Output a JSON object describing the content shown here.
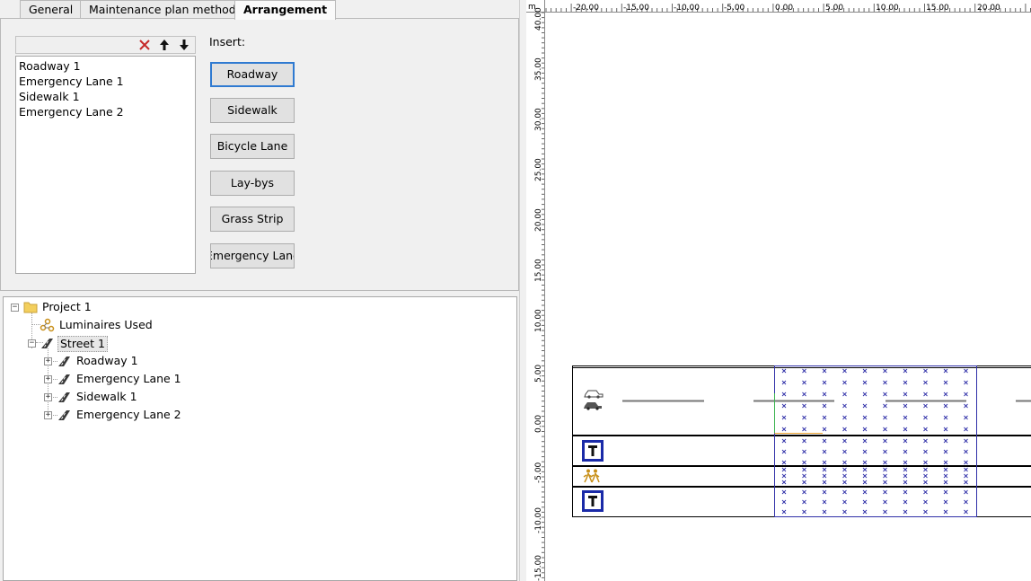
{
  "tabs": [
    {
      "label": "General"
    },
    {
      "label": "Maintenance plan method"
    },
    {
      "label": "Arrangement"
    }
  ],
  "arrangement": {
    "list_items": [
      "Roadway 1",
      "Emergency Lane 1",
      "Sidewalk 1",
      "Emergency Lane 2"
    ],
    "insert_label": "Insert:",
    "insert_buttons": [
      "Roadway",
      "Sidewalk",
      "Bicycle Lane",
      "Lay-bys",
      "Grass Strip",
      "Emergency Lane"
    ],
    "toolbar_icons": [
      "delete-icon",
      "move-up-icon",
      "move-down-icon"
    ]
  },
  "tree": {
    "project": "Project 1",
    "luminaires": "Luminaires Used",
    "street": "Street 1",
    "children": [
      "Roadway 1",
      "Emergency Lane 1",
      "Sidewalk 1",
      "Emergency Lane 2"
    ]
  },
  "ruler": {
    "unit": "m",
    "x_ticks": [
      "-20.00",
      "-15.00",
      "-10.00",
      "-5.00",
      "0.00",
      "5.00",
      "10.00",
      "15.00",
      "20.00"
    ],
    "y_ticks": [
      "40.00",
      "35.00",
      "30.00",
      "25.00",
      "20.00",
      "15.00",
      "10.00",
      "5.00",
      "0.00",
      "-5.00",
      "-10.00",
      "-15.00"
    ]
  },
  "colors": {
    "grid_blue": "#2f2fa8",
    "sign_blue": "#1a2aa8",
    "pedestrian_gold": "#c8901a",
    "folder_yellow": "#f3cf5d",
    "delete_red": "#c62828",
    "default_button_blue": "#2f7ad1"
  }
}
